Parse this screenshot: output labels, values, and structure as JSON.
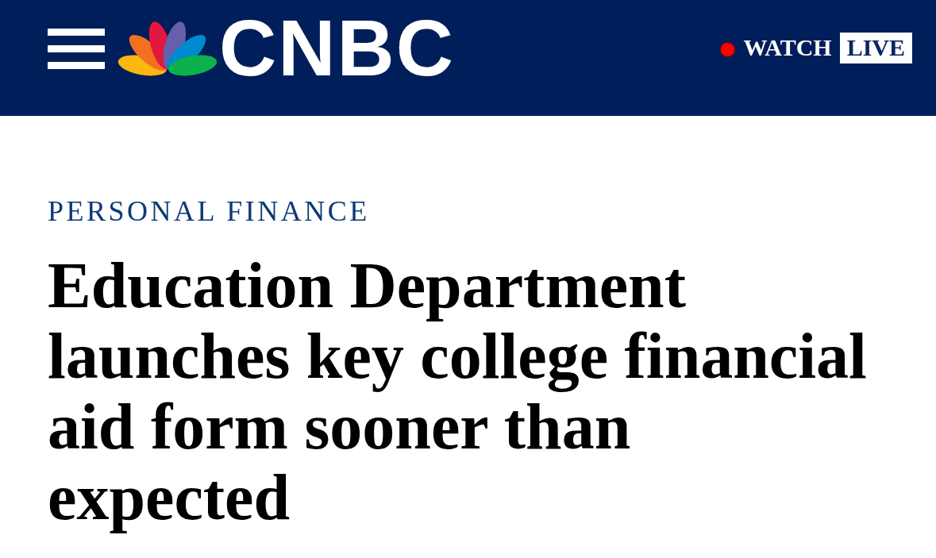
{
  "header": {
    "brand": "CNBC",
    "watch": {
      "label": "WATCH",
      "badge": "LIVE"
    }
  },
  "article": {
    "section": "PERSONAL FINANCE",
    "headline": "Education Department launches key college financial aid form sooner than expected"
  }
}
